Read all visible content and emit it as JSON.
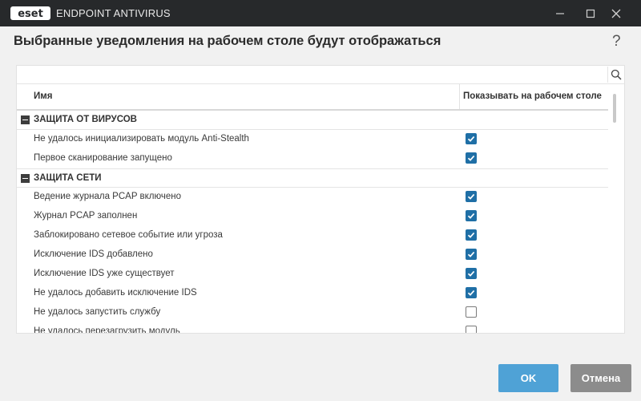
{
  "window": {
    "logo_text": "eset",
    "title": "ENDPOINT ANTIVIRUS"
  },
  "dialog": {
    "heading": "Выбранные уведомления на рабочем столе будут отображаться",
    "help": "?"
  },
  "search": {
    "value": "",
    "placeholder": ""
  },
  "table": {
    "col_name": "Имя",
    "col_show": "Показывать на рабочем столе"
  },
  "groups": [
    {
      "label": "ЗАЩИТА ОТ ВИРУСОВ",
      "items": [
        {
          "label": "Не удалось инициализировать модуль Anti-Stealth",
          "checked": true
        },
        {
          "label": "Первое сканирование запущено",
          "checked": true
        }
      ]
    },
    {
      "label": "ЗАЩИТА СЕТИ",
      "items": [
        {
          "label": "Ведение журнала PCAP включено",
          "checked": true
        },
        {
          "label": "Журнал PCAP заполнен",
          "checked": true
        },
        {
          "label": "Заблокировано сетевое событие или угроза",
          "checked": true
        },
        {
          "label": "Исключение IDS добавлено",
          "checked": true
        },
        {
          "label": "Исключение IDS уже существует",
          "checked": true
        },
        {
          "label": "Не удалось добавить исключение IDS",
          "checked": true
        },
        {
          "label": "Не удалось запустить службу",
          "checked": false
        },
        {
          "label": "Не удалось перезагрузить модуль",
          "checked": false
        }
      ]
    }
  ],
  "buttons": {
    "ok": "OK",
    "cancel": "Отмена"
  },
  "colors": {
    "titlebar": "#27292b",
    "accent": "#1f6fa6",
    "ok_button": "#4fa2d6",
    "cancel_button": "#8c8c8c"
  }
}
